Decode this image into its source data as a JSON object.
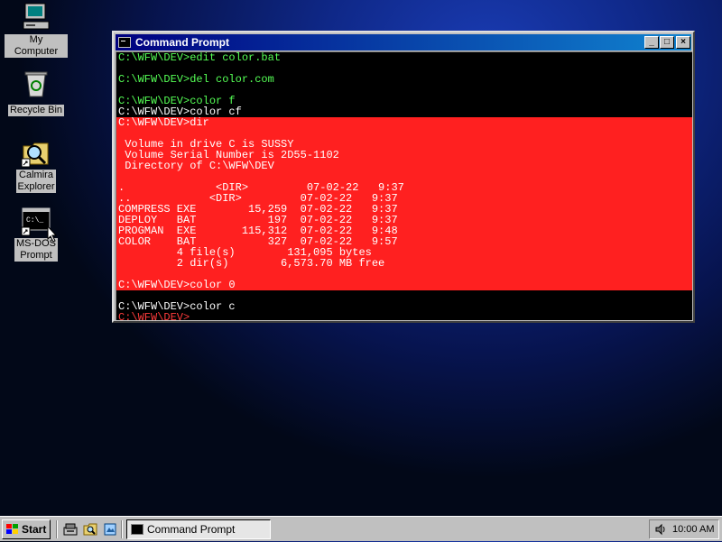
{
  "desktop": {
    "icons": [
      {
        "label": "My Computer",
        "icon": "my-computer-icon"
      },
      {
        "label": "Recycle Bin",
        "icon": "recycle-bin-icon"
      },
      {
        "label": "Calmira Explorer",
        "label_lines": [
          "Calmira",
          "Explorer"
        ],
        "icon": "calmira-explorer-icon"
      },
      {
        "label": "MS-DOS Prompt",
        "label_lines": [
          "MS-DOS",
          "Prompt"
        ],
        "icon": "ms-dos-prompt-icon"
      }
    ],
    "colors": {
      "background": "#0f2888",
      "console_bg": "#000000",
      "console_highlight": "#ff2020",
      "prompt_green": "#55ff55"
    }
  },
  "window": {
    "title": "Command Prompt",
    "buttons": {
      "minimize": "_",
      "maximize": "□",
      "close": "×"
    },
    "console_lines": [
      "C:\\WFW\\DEV>edit color.bat",
      "",
      "C:\\WFW\\DEV>del color.com",
      "",
      "C:\\WFW\\DEV>color f",
      "C:\\WFW\\DEV>color cf",
      "C:\\WFW\\DEV>dir",
      "",
      " Volume in drive C is SUSSY",
      " Volume Serial Number is 2D55-1102",
      " Directory of C:\\WFW\\DEV",
      "",
      ".              <DIR>         07-02-22   9:37",
      "..            <DIR>         07-02-22   9:37",
      "COMPRESS EXE        15,259  07-02-22   9:37",
      "DEPLOY   BAT           197  07-02-22   9:37",
      "PROGMAN  EXE       115,312  07-02-22   9:48",
      "COLOR    BAT           327  07-02-22   9:57",
      "         4 file(s)        131,095 bytes",
      "         2 dir(s)        6,573.70 MB free",
      "",
      "C:\\WFW\\DEV>color 0",
      "",
      "C:\\WFW\\DEV>color c",
      "C:\\WFW\\DEV>"
    ]
  },
  "taskbar": {
    "start_label": "Start",
    "quick_launch": [
      "quick-launch-program-manager-icon",
      "quick-launch-explorer-icon",
      "quick-launch-file-icon"
    ],
    "task_buttons": [
      {
        "label": "Command Prompt",
        "icon": "command-prompt-icon"
      }
    ],
    "clock": "10:00 AM"
  }
}
